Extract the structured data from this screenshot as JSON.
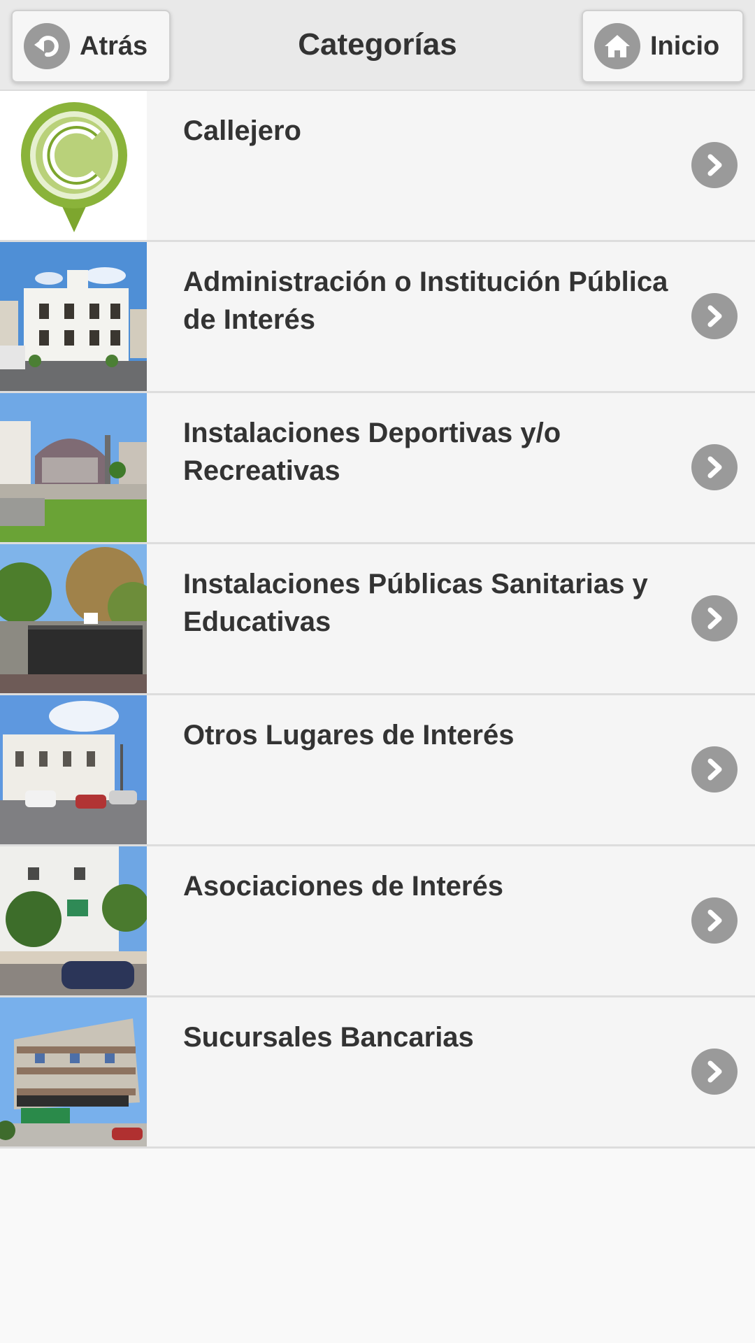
{
  "header": {
    "title": "Categorías",
    "back_label": "Atrás",
    "home_label": "Inicio"
  },
  "categories": [
    {
      "label": "Callejero"
    },
    {
      "label": "Administración o Institución Pública de Interés"
    },
    {
      "label": "Instalaciones Deportivas y/o Recreativas"
    },
    {
      "label": "Instalaciones Públicas Sanitarias y Educativas"
    },
    {
      "label": "Otros Lugares de Interés"
    },
    {
      "label": "Asociaciones de Interés"
    },
    {
      "label": "Sucursales Bancarias"
    }
  ],
  "colors": {
    "header_bg": "#e9e9e9",
    "item_bg": "#f5f5f5",
    "icon_circle": "#9a9a9a",
    "logo_green": "#8ab33a"
  },
  "icons": {
    "back": "back-arrow-icon",
    "home": "home-icon",
    "chevron": "chevron-right-icon"
  }
}
